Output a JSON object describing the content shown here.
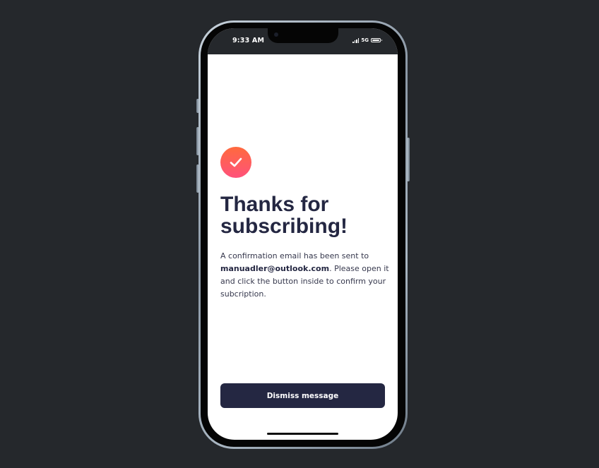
{
  "status_bar": {
    "time": "9:33 AM",
    "network": "5G"
  },
  "icons": {
    "success": "check-circle-icon",
    "signal": "signal-icon",
    "battery": "battery-icon"
  },
  "colors": {
    "background": "#25282c",
    "heading": "#242742",
    "button": "#242742",
    "icon_gradient_start": "#ff6a3d",
    "icon_gradient_end": "#ff527b"
  },
  "content": {
    "headline": "Thanks for subscribing!",
    "message_prefix": "A confirmation email has been sent to ",
    "email": "manuadler@outlook.com",
    "message_suffix": ". Please open it and click the button inside to confirm your subcription."
  },
  "actions": {
    "dismiss_label": "Dismiss message"
  }
}
